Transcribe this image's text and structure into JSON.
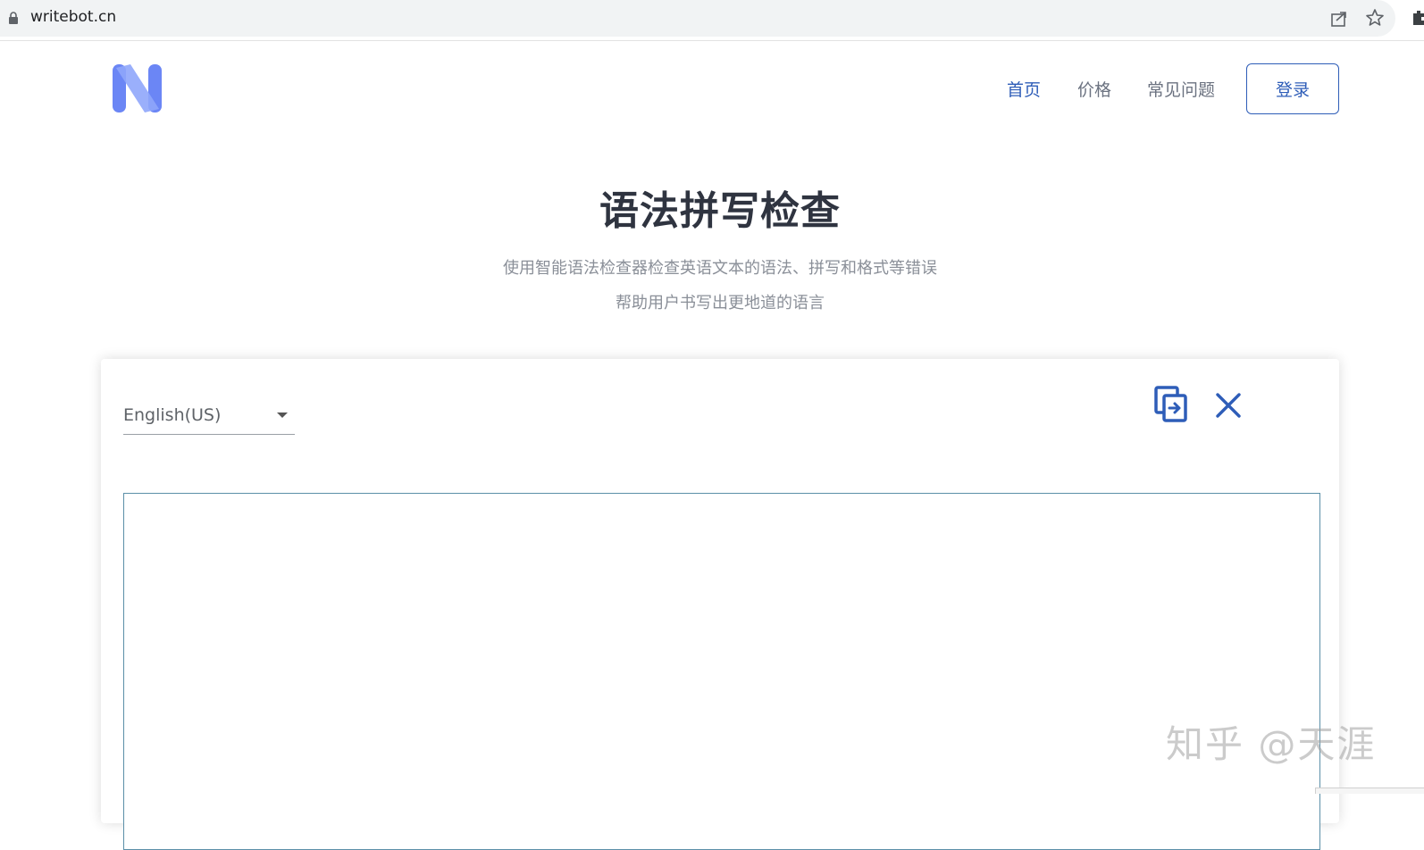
{
  "browser": {
    "url": "writebot.cn"
  },
  "header": {
    "nav": {
      "home": "首页",
      "price": "价格",
      "faq": "常见问题"
    },
    "login_label": "登录"
  },
  "hero": {
    "title": "语法拼写检查",
    "subtitle_line1": "使用智能语法检查器检查英语文本的语法、拼写和格式等错误",
    "subtitle_line2": "帮助用户书写出更地道的语言"
  },
  "editor": {
    "language": "English(US)",
    "text": ""
  },
  "watermark": "知乎 @天涯",
  "colors": {
    "accent": "#2e5db8",
    "logo": "#6b86f5",
    "title": "#2f3440",
    "muted": "#8a8f98"
  }
}
